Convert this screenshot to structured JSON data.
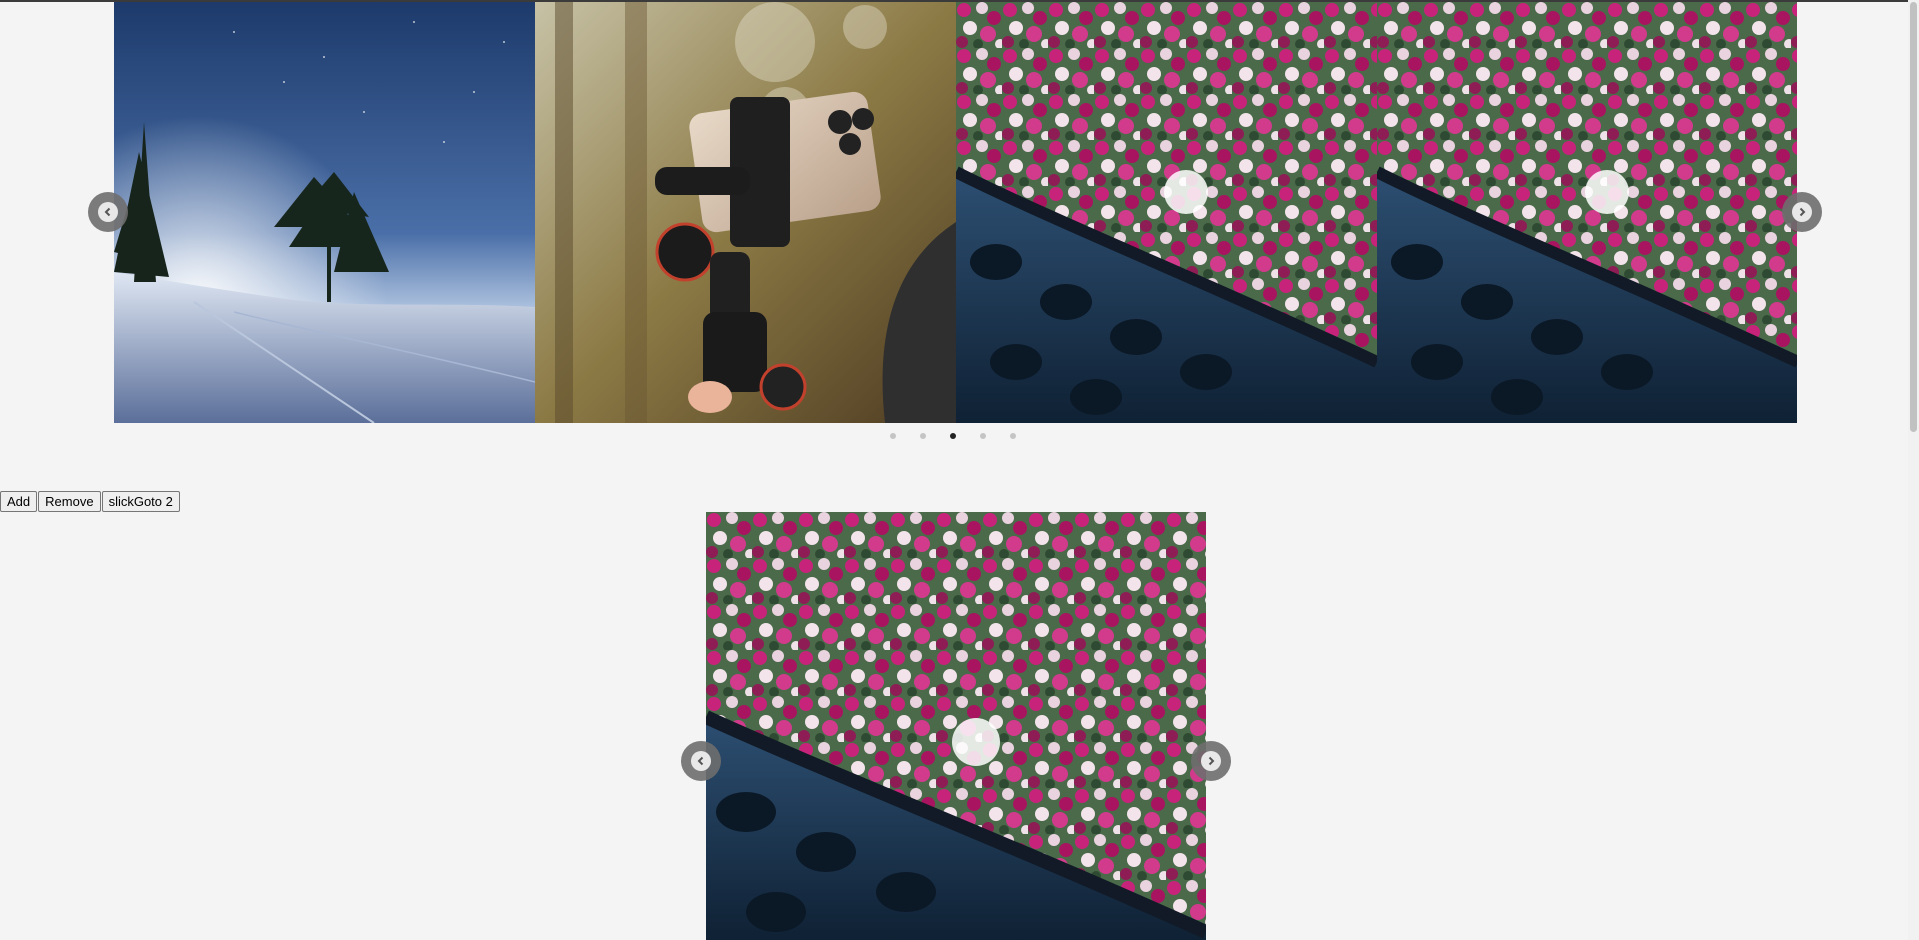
{
  "carousel_top": {
    "slides": [
      {
        "image": "snowy-night-landscape-with-pine-trees"
      },
      {
        "image": "smartphone-on-handheld-gimbal"
      },
      {
        "image": "pink-bougainvillea-over-tiled-roof"
      },
      {
        "image": "pink-bougainvillea-over-tiled-roof"
      }
    ],
    "prev_icon": "chevron-left-icon",
    "next_icon": "chevron-right-icon",
    "dots_count": 5,
    "active_dot_index": 3
  },
  "controls": {
    "add_label": "Add",
    "remove_label": "Remove",
    "goto_label": "slickGoto 2"
  },
  "carousel_bottom": {
    "slide": {
      "image": "pink-bougainvillea-over-tiled-roof"
    },
    "prev_icon": "chevron-left-icon",
    "next_icon": "chevron-right-icon"
  },
  "colors": {
    "background": "#f4f4f4",
    "arrow": "#6e6e6e",
    "dot_active": "#222222",
    "dot_inactive": "#c4c4c4"
  }
}
